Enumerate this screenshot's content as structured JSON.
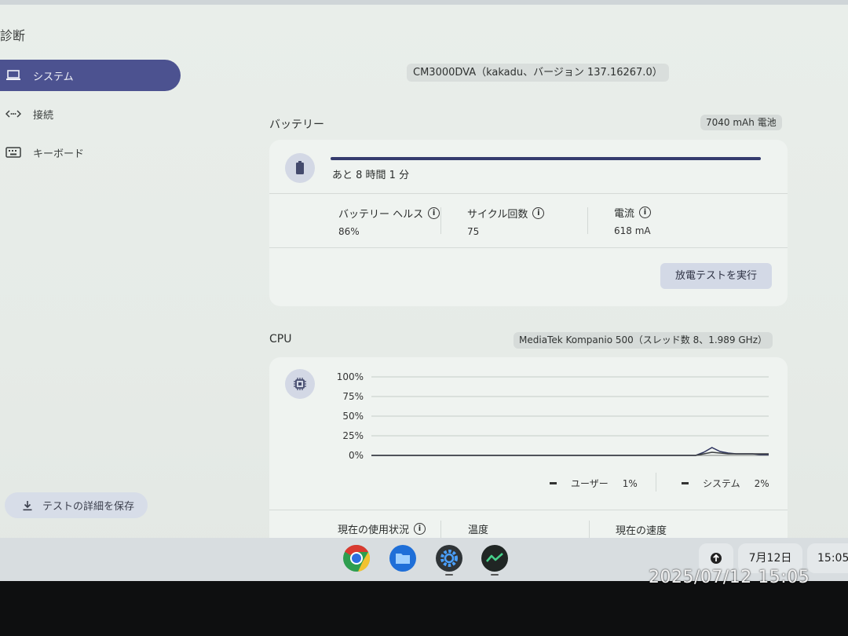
{
  "app": {
    "title": "診断"
  },
  "nav": {
    "items": [
      {
        "label": "システム",
        "icon": "laptop-icon",
        "active": true
      },
      {
        "label": "接続",
        "icon": "connection-icon",
        "active": false
      },
      {
        "label": "キーボード",
        "icon": "keyboard-icon",
        "active": false
      }
    ]
  },
  "save_button": {
    "label": "テストの詳細を保存",
    "icon": "download-icon"
  },
  "device": {
    "info": "CM3000DVA（kakadu、バージョン 137.16267.0）"
  },
  "battery": {
    "title": "バッテリー",
    "capacity": "7040 mAh 電池",
    "icon": "battery-icon",
    "charge_fraction": 1.0,
    "remaining": "あと 8 時間 1 分",
    "stats": [
      {
        "label": "バッテリー ヘルス",
        "value": "86%"
      },
      {
        "label": "サイクル回数",
        "value": "75"
      },
      {
        "label": "電流",
        "value": "618 mA"
      }
    ],
    "run_button": "放電テストを実行"
  },
  "cpu": {
    "title": "CPU",
    "model": "MediaTek Kompanio 500（スレッド数 8、1.989 GHz）",
    "icon": "chip-icon",
    "legend": [
      {
        "label": "ユーザー",
        "value": "1%"
      },
      {
        "label": "システム",
        "value": "2%"
      }
    ],
    "stats": [
      {
        "label": "現在の使用状況"
      },
      {
        "label": "温度"
      },
      {
        "label": "現在の速度"
      }
    ]
  },
  "chart_data": {
    "type": "line",
    "yticks": [
      "100%",
      "75%",
      "50%",
      "25%",
      "0%"
    ],
    "ylim": [
      0,
      100
    ],
    "x": [
      0,
      1,
      2,
      3,
      4,
      5,
      6,
      7,
      8,
      9,
      10,
      11,
      12,
      13,
      14,
      15,
      16,
      17,
      18,
      19,
      20,
      21,
      22,
      23,
      24,
      25,
      26,
      27,
      28,
      29,
      30,
      31,
      32,
      33,
      34,
      35,
      36,
      37,
      38,
      39,
      40,
      41,
      42,
      43,
      44,
      45,
      46,
      47,
      48,
      49
    ],
    "series": [
      {
        "name": "ユーザー",
        "values": [
          0,
          0,
          0,
          0,
          0,
          0,
          0,
          0,
          0,
          0,
          0,
          0,
          0,
          0,
          0,
          0,
          0,
          0,
          0,
          0,
          0,
          0,
          0,
          0,
          0,
          0,
          0,
          0,
          0,
          0,
          0,
          0,
          0,
          0,
          0,
          0,
          0,
          0,
          0,
          0,
          0,
          4,
          10,
          5,
          3,
          2,
          2,
          2,
          1,
          1
        ]
      },
      {
        "name": "システム",
        "values": [
          0,
          0,
          0,
          0,
          0,
          0,
          0,
          0,
          0,
          0,
          0,
          0,
          0,
          0,
          0,
          0,
          0,
          0,
          0,
          0,
          0,
          0,
          0,
          0,
          0,
          0,
          0,
          0,
          0,
          0,
          0,
          0,
          0,
          0,
          0,
          0,
          0,
          0,
          0,
          0,
          0,
          2,
          4,
          3,
          2,
          2,
          2,
          2,
          2,
          2
        ]
      }
    ],
    "colors": [
      "#2f3560",
      "#3a3d40"
    ],
    "grid": true
  },
  "shelf": {
    "apps": [
      {
        "name": "chrome-icon"
      },
      {
        "name": "files-icon"
      },
      {
        "name": "settings-icon"
      },
      {
        "name": "diagnostics-icon"
      }
    ],
    "date": "7月12日",
    "time": "15:05"
  },
  "photo_stamp": "2025/07/12 15:05"
}
